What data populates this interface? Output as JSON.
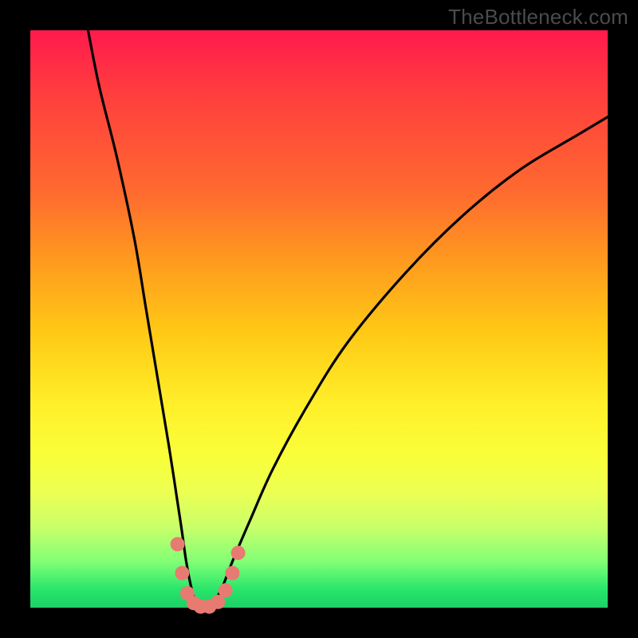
{
  "watermark": "TheBottleneck.com",
  "chart_data": {
    "type": "line",
    "title": "",
    "xlabel": "",
    "ylabel": "",
    "xlim": [
      0,
      100
    ],
    "ylim": [
      0,
      100
    ],
    "gradient_stops": [
      {
        "pos": 0,
        "color": "#ff1a4d"
      },
      {
        "pos": 28,
        "color": "#ff6a2f"
      },
      {
        "pos": 52,
        "color": "#ffc815"
      },
      {
        "pos": 74,
        "color": "#f9ff3a"
      },
      {
        "pos": 92,
        "color": "#82ff76"
      },
      {
        "pos": 100,
        "color": "#1ece66"
      }
    ],
    "series": [
      {
        "name": "bottleneck-curve",
        "x": [
          10,
          12,
          15,
          18,
          20,
          22,
          24,
          26,
          27,
          28,
          29,
          30,
          31,
          33,
          35,
          38,
          42,
          48,
          55,
          65,
          75,
          85,
          95,
          100
        ],
        "y": [
          100,
          90,
          78,
          64,
          52,
          40,
          28,
          15,
          8,
          3,
          0,
          0,
          0,
          3,
          8,
          15,
          24,
          35,
          46,
          58,
          68,
          76,
          82,
          85
        ]
      }
    ],
    "markers": [
      {
        "name": "highlight-point",
        "x": 25.5,
        "y": 11
      },
      {
        "name": "highlight-point",
        "x": 26.3,
        "y": 6
      },
      {
        "name": "highlight-point",
        "x": 27.2,
        "y": 2.5
      },
      {
        "name": "highlight-point",
        "x": 28.3,
        "y": 0.8
      },
      {
        "name": "highlight-point",
        "x": 29.5,
        "y": 0.2
      },
      {
        "name": "highlight-point",
        "x": 31.0,
        "y": 0.2
      },
      {
        "name": "highlight-point",
        "x": 32.5,
        "y": 1.0
      },
      {
        "name": "highlight-point",
        "x": 33.8,
        "y": 3.0
      },
      {
        "name": "highlight-point",
        "x": 35.0,
        "y": 6.0
      },
      {
        "name": "highlight-point",
        "x": 36.0,
        "y": 9.5
      }
    ],
    "marker_color": "#e77b72",
    "curve_color": "#000000"
  }
}
